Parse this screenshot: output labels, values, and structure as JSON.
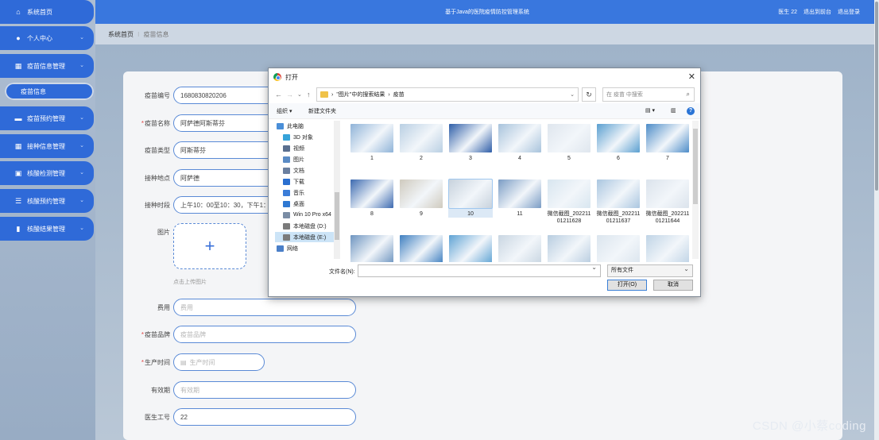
{
  "header": {
    "title": "基于Java的医院疫情防控管理系统",
    "user": "医生 22",
    "back_link": "退出到前台",
    "logout_link": "退出登录"
  },
  "sidebar": {
    "items": [
      {
        "label": "系统首页",
        "icon": "home-icon"
      },
      {
        "label": "个人中心",
        "icon": "user-icon"
      },
      {
        "label": "疫苗信息管理",
        "icon": "grid-icon"
      },
      {
        "label": "疫苗预约管理",
        "icon": "monitor-icon"
      },
      {
        "label": "接种信息管理",
        "icon": "grid-icon"
      },
      {
        "label": "核酸检测管理",
        "icon": "box-icon"
      },
      {
        "label": "核酸预约管理",
        "icon": "list-icon"
      },
      {
        "label": "核酸结果管理",
        "icon": "bar-chart-icon"
      }
    ],
    "submenu_active": "疫苗信息"
  },
  "breadcrumb": {
    "home": "系统首页",
    "current": "疫苗信息"
  },
  "form": {
    "vaccine_id": {
      "label": "疫苗编号",
      "value": "1680830820206"
    },
    "vaccine_name": {
      "label": "疫苗名称",
      "value": "阿萨德阿斯蒂芬"
    },
    "vaccine_type": {
      "label": "疫苗类型",
      "value": "阿斯蒂芬"
    },
    "location": {
      "label": "接种地点",
      "value": "阿萨德"
    },
    "time": {
      "label": "接种时段",
      "value": "上午10：00至10：30，下午1："
    },
    "image": {
      "label": "图片",
      "tip": "点击上传图片"
    },
    "fee": {
      "label": "费用",
      "placeholder": "费用"
    },
    "brand": {
      "label": "疫苗品牌",
      "placeholder": "疫苗品牌"
    },
    "production_time": {
      "label": "生产时间",
      "placeholder": "生产时间"
    },
    "validity": {
      "label": "有效期",
      "placeholder": "有效期"
    },
    "doctor_id": {
      "label": "医生工号",
      "value": "22"
    }
  },
  "dialog": {
    "title": "打开",
    "path": [
      "\"图片\"中的搜索结果",
      "疫苗"
    ],
    "search_placeholder": "在 疫苗 中搜索",
    "organize": "组织 ▾",
    "new_folder": "新建文件夹",
    "tree": [
      "此电脑",
      "3D 对象",
      "视频",
      "图片",
      "文档",
      "下载",
      "音乐",
      "桌面",
      "Win 10 Pro x64",
      "本地磁盘 (D:)",
      "本地磁盘 (E:)",
      "网络"
    ],
    "tree_colors": [
      "#4a8fd8",
      "#36a3d9",
      "#5a6f8f",
      "#5a8bc5",
      "#6a7fa0",
      "#2a6fd0",
      "#3b7dd8",
      "#2e78d2",
      "#7b8da5",
      "#7b7b7b",
      "#7b7b7b",
      "#4a7fc8"
    ],
    "files": [
      "1",
      "2",
      "3",
      "4",
      "5",
      "6",
      "7",
      "8",
      "9",
      "10",
      "11",
      "微信截图_20221101211628",
      "微信截图_20221101211637",
      "微信截图_20221101211644",
      "",
      "",
      "",
      "",
      "",
      "",
      ""
    ],
    "thumb_colors": [
      "#8fb3d8",
      "#b9cfe3",
      "#2f5ea8",
      "#a8c3dc",
      "#dfe6ee",
      "#5a9fd0",
      "#4d8cc8",
      "#3d6ab0",
      "#cfcabe",
      "#c7d2dd",
      "#7a9cc4",
      "#d8e6f0",
      "#aac6e0",
      "#dbe3ec",
      "#6e95c0",
      "#3f7fc0",
      "#5fa3d4",
      "#c9d6e2",
      "#b8cde0",
      "#dbe5ee",
      "#c0d4e6"
    ],
    "filename_label": "文件名(N):",
    "filetype": "所有文件",
    "open_button": "打开(O)",
    "cancel_button": "取消"
  },
  "watermark": "CSDN @小蔡coding"
}
